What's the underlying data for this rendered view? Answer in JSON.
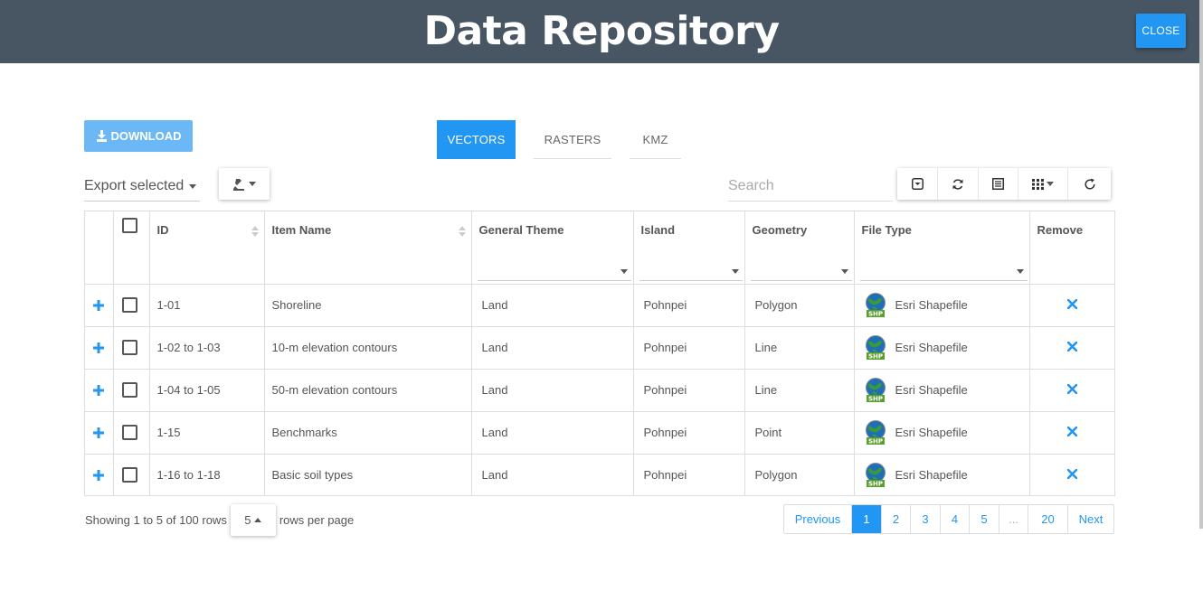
{
  "header": {
    "title": "Data Repository",
    "close_label": "CLOSE"
  },
  "toolbar": {
    "download_label": "DOWNLOAD",
    "export_select_value": "Export selected",
    "search_placeholder": "Search"
  },
  "tabs": [
    {
      "label": "VECTORS",
      "active": true
    },
    {
      "label": "RASTERS",
      "active": false
    },
    {
      "label": "KMZ",
      "active": false
    }
  ],
  "table": {
    "columns": [
      "ID",
      "Item Name",
      "General Theme",
      "Island",
      "Geometry",
      "File Type",
      "Remove"
    ],
    "rows": [
      {
        "id": "1-01",
        "name": "Shoreline",
        "theme": "Land",
        "island": "Pohnpei",
        "geometry": "Polygon",
        "file_type": "Esri Shapefile"
      },
      {
        "id": "1-02 to 1-03",
        "name": "10-m elevation contours",
        "theme": "Land",
        "island": "Pohnpei",
        "geometry": "Line",
        "file_type": "Esri Shapefile"
      },
      {
        "id": "1-04 to 1-05",
        "name": "50-m elevation contours",
        "theme": "Land",
        "island": "Pohnpei",
        "geometry": "Line",
        "file_type": "Esri Shapefile"
      },
      {
        "id": "1-15",
        "name": "Benchmarks",
        "theme": "Land",
        "island": "Pohnpei",
        "geometry": "Point",
        "file_type": "Esri Shapefile"
      },
      {
        "id": "1-16 to 1-18",
        "name": "Basic soil types",
        "theme": "Land",
        "island": "Pohnpei",
        "geometry": "Polygon",
        "file_type": "Esri Shapefile"
      }
    ],
    "shp_badge": "SHP"
  },
  "footer": {
    "showing_text": "Showing 1 to 5 of 100 rows",
    "rows_per_page_value": "5",
    "rows_per_page_label": "rows per page"
  },
  "pagination": {
    "previous": "Previous",
    "pages": [
      "1",
      "2",
      "3",
      "4",
      "5",
      "...",
      "20"
    ],
    "active_page": "1",
    "next": "Next"
  },
  "colors": {
    "header_bg": "#485563",
    "accent": "#2196f3",
    "download_bg": "#6cb7f5"
  },
  "icons": [
    "download-icon",
    "export-type-icon",
    "toggle-pagination-icon",
    "refresh-icon",
    "toggle-view-icon",
    "columns-icon",
    "reset-icon",
    "plus-icon",
    "close-x-icon",
    "shapefile-globe-icon"
  ]
}
